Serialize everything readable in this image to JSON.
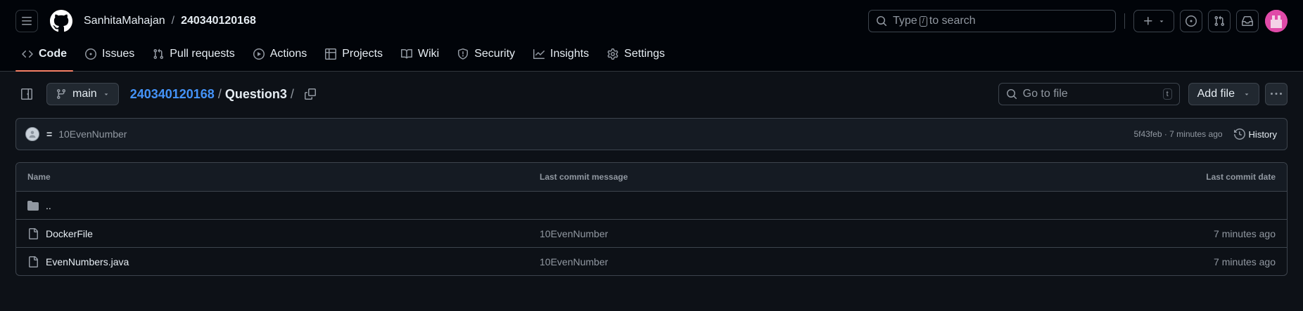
{
  "header": {
    "repo_owner": "SanhitaMahajan",
    "repo_separator": "/",
    "repo_name": "240340120168",
    "search": {
      "prefix": "Type",
      "key": "/",
      "suffix": "to search"
    }
  },
  "tabs": [
    {
      "label": "Code",
      "icon": "code-icon",
      "active": true
    },
    {
      "label": "Issues",
      "icon": "issue-icon"
    },
    {
      "label": "Pull requests",
      "icon": "pull-request-icon"
    },
    {
      "label": "Actions",
      "icon": "play-icon"
    },
    {
      "label": "Projects",
      "icon": "table-icon"
    },
    {
      "label": "Wiki",
      "icon": "book-icon"
    },
    {
      "label": "Security",
      "icon": "shield-icon"
    },
    {
      "label": "Insights",
      "icon": "graph-icon"
    },
    {
      "label": "Settings",
      "icon": "gear-icon"
    }
  ],
  "subbar": {
    "branch": "main",
    "breadcrumb_repo": "240340120168",
    "breadcrumb_sep": "/",
    "breadcrumb_current": "Question3",
    "breadcrumb_trailing_sep": "/",
    "goto_placeholder": "Go to file",
    "goto_key": "t",
    "add_file": "Add file"
  },
  "commit": {
    "author_mark": "=",
    "message": "10EvenNumber",
    "meta": "5f43feb · 7 minutes ago",
    "history_label": "History"
  },
  "table": {
    "headers": {
      "name": "Name",
      "message": "Last commit message",
      "date": "Last commit date"
    },
    "parent_dir": "..",
    "rows": [
      {
        "name": "DockerFile",
        "message": "10EvenNumber",
        "date": "7 minutes ago"
      },
      {
        "name": "EvenNumbers.java",
        "message": "10EvenNumber",
        "date": "7 minutes ago"
      }
    ]
  },
  "colors": {
    "background": "#0d1117",
    "header_bg": "#010409",
    "accent_link": "#4493f8",
    "active_tab_underline": "#f78166",
    "avatar": "#e04aa8"
  }
}
